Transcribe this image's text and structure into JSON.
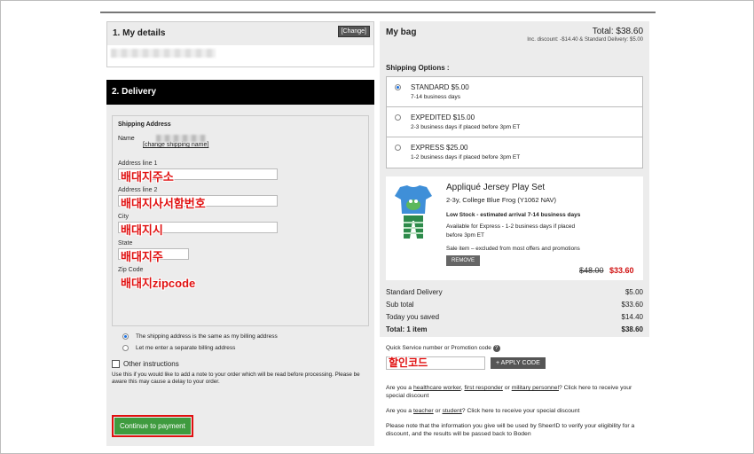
{
  "details": {
    "title": "1. My details",
    "change_label": "[Change]"
  },
  "delivery": {
    "title": "2. Delivery",
    "legend": "Shipping Address",
    "name_label": "Name",
    "change_name_link": "[change shipping name]",
    "fields": [
      {
        "label": "Address line 1",
        "value": "배대지주소"
      },
      {
        "label": "Address line 2",
        "value": "배대지사서함번호"
      },
      {
        "label": "City",
        "value": "배대지시"
      },
      {
        "label": "State",
        "value": "배대지주"
      },
      {
        "label": "Zip Code",
        "value": "배대지zipcode"
      }
    ],
    "billing_same": "The shipping address is the same as my billing address",
    "billing_separate": "Let me enter a separate billing address",
    "other_instructions": "Other instructions",
    "note": "Use this if you would like to add a note to your order which will be read before processing. Please be aware this may cause a delay to your order.",
    "pay_button": "Continue to payment"
  },
  "bag": {
    "title": "My bag",
    "total": "Total: $38.60",
    "sub": "Inc. discount: -$14.40 & Standard Delivery: $5.00",
    "shipping_title": "Shipping Options :",
    "options": [
      {
        "name": "STANDARD $5.00",
        "desc": "7-14 business days",
        "selected": true
      },
      {
        "name": "EXPEDITED $15.00",
        "desc": "2-3 business days if placed before 3pm ET",
        "selected": false
      },
      {
        "name": "EXPRESS $25.00",
        "desc": "1-2 business days if placed before 3pm ET",
        "selected": false
      }
    ],
    "product": {
      "title": "Appliqué Jersey Play Set",
      "variant": "2-3y, College Blue Frog (Y1062 NAV)",
      "stock": "Low Stock - estimated arrival 7-14 business days",
      "express": "Available for Express - 1-2 business days if placed before 3pm ET",
      "sale": "Sale item – excluded from most offers and promotions",
      "remove": "REMOVE",
      "old_price": "$48.00",
      "new_price": "$33.60"
    },
    "summary": [
      {
        "label": "Standard Delivery",
        "value": "$5.00"
      },
      {
        "label": "Sub total",
        "value": "$33.60"
      },
      {
        "label": "Today you saved",
        "value": "$14.40"
      },
      {
        "label": "Total: 1 item",
        "value": "$38.60"
      }
    ]
  },
  "promo": {
    "label": "Quick Service number or Promotion code",
    "code_value": "할인코드",
    "apply": "+ APPLY CODE",
    "info1_a": "Are you a ",
    "info1_link1": "healthcare worker",
    "info1_b": ", ",
    "info1_link2": "first responder",
    "info1_c": " or ",
    "info1_link3": "military personnel",
    "info1_d": "? Click here to receive your special discount",
    "info2_a": "Are you a ",
    "info2_link1": "teacher",
    "info2_b": " or ",
    "info2_link2": "student",
    "info2_c": "? Click here to receive your special discount",
    "info3": "Please note that the information you give will be used by SheerID to verify your eligibility for a discount, and the results will be passed back to Boden"
  }
}
